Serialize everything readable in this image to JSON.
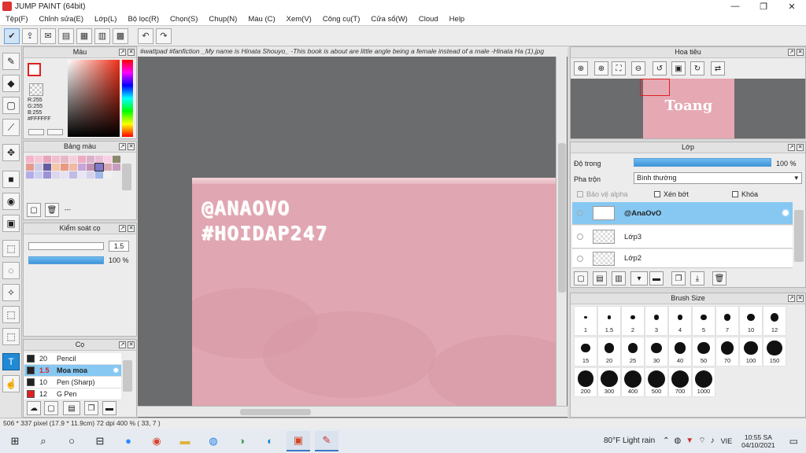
{
  "window": {
    "title": "JUMP PAINT (64bit)",
    "minimize": "—",
    "restore": "❐",
    "close": "✕"
  },
  "menu": [
    "Tệp(F)",
    "Chỉnh sửa(E)",
    "Lớp(L)",
    "Bộ lọc(R)",
    "Chọn(S)",
    "Chụp(N)",
    "Màu (C)",
    "Xem(V)",
    "Công cụ(T)",
    "Cửa sổ(W)",
    "Cloud",
    "Help"
  ],
  "document": {
    "tab_title": "#wattpad #fanfiction _My name is Hinata Shouyo_ -This book is about are little angle being a female instead of a male -Hinata Ha (1).jpg",
    "text_line1": "@ANAOVO",
    "text_line2": "#HOIDAP247"
  },
  "color_panel": {
    "title": "Màu",
    "r": "R:255",
    "g": "G:255",
    "b": "B:255",
    "hex": "#FFFFFF"
  },
  "palette_panel": {
    "title": "Bảng màu",
    "more": "---"
  },
  "pen_control": {
    "title": "Kiểm soát cọ",
    "size": "1.5",
    "opacity": "100 %"
  },
  "brush_panel": {
    "title": "Cọ",
    "items": [
      {
        "size": "20",
        "name": "Pencil",
        "color": "#222222"
      },
      {
        "size": "1.5",
        "name": "Moa moa",
        "color": "#222222"
      },
      {
        "size": "10",
        "name": "Pen (Sharp)",
        "color": "#222222"
      },
      {
        "size": "12",
        "name": "G Pen",
        "color": "#e02020"
      }
    ]
  },
  "navigator": {
    "title": "Hoa tiêu",
    "preview_text": "Toang"
  },
  "layer_panel": {
    "title": "Lớp",
    "opacity_label": "Độ trong",
    "opacity_value": "100 %",
    "blend_label": "Pha trộn",
    "blend_value": "Bình thường",
    "protect_alpha": "Bảo vệ alpha",
    "clipping": "Xén bớt",
    "lock": "Khóa",
    "layers": [
      "@AnaOvO",
      "Lớp3",
      "Lớp2"
    ]
  },
  "brush_size_panel": {
    "title": "Brush Size",
    "sizes": [
      "1",
      "1.5",
      "2",
      "3",
      "4",
      "5",
      "7",
      "10",
      "12",
      "15",
      "20",
      "25",
      "30",
      "40",
      "50",
      "70",
      "100",
      "150",
      "200",
      "300",
      "400",
      "500",
      "700",
      "1000"
    ]
  },
  "status": "506 * 337 pixel   (17.9 * 11.9cm)   72 dpi   400 %   ( 33, 7 )",
  "taskbar": {
    "weather": "80°F  Light rain",
    "lang": "VIE",
    "time": "10:55 SA",
    "date": "04/10/2021"
  }
}
